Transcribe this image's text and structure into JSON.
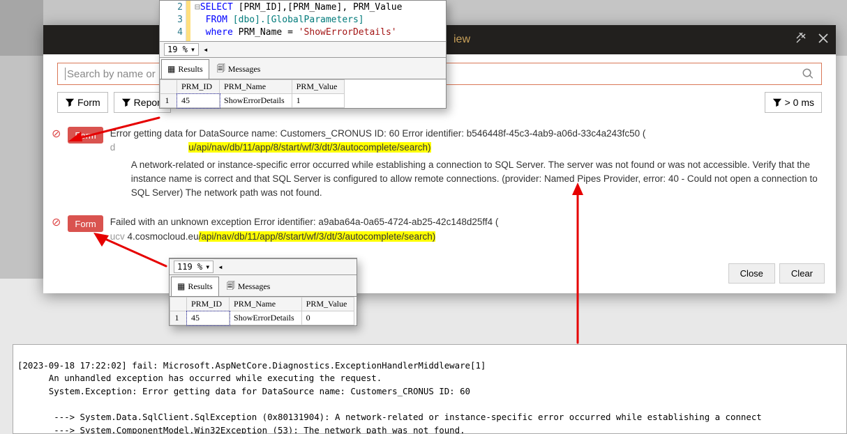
{
  "dialog": {
    "title_fragment": "iew",
    "search_placeholder": "Search by name or",
    "filters": {
      "form": "Form",
      "report": "Report",
      "ms": "> 0 ms"
    },
    "entries": [
      {
        "badge": "Form",
        "msg_pre": "Error getting data for DataSource name: Customers_CRONUS ID: 60 Error identifier: b546448f-45c3-4ab9-a06d-33c4a243fc50 (",
        "msg_hl": "u/api/nav/db/11/app/8/start/wf/3/dt/3/autocomplete/search)",
        "detail": "A network-related or instance-specific error occurred while establishing a connection to SQL Server. The server was not found or was not accessible. Verify that the instance name is correct and that SQL Server is configured to allow remote connections. (provider: Named Pipes Provider, error: 40 - Could not open a connection to SQL Server) The network path was not found."
      },
      {
        "badge": "Form",
        "msg_pre": "Failed with an unknown exception Error identifier: a9aba64a-0a65-4724-ab25-42c148d25ff4 (",
        "msg_mid": "4.cosmocloud.eu",
        "msg_hl": "/api/nav/db/11/app/8/start/wf/3/dt/3/autocomplete/search)"
      }
    ],
    "buttons": {
      "close": "Close",
      "clear": "Clear"
    }
  },
  "sql": {
    "lines": [
      "2",
      "3",
      "4"
    ],
    "sel": "SELECT ",
    "cols": "[PRM_ID],[PRM_Name], PRM_Value",
    "from": "FROM ",
    "tbl": "[dbo].[GlobalParameters]",
    "where": "where ",
    "eqcol": "PRM_Name = ",
    "val": "'ShowErrorDetails'",
    "zoom_top": "19 %",
    "zoom_bottom": "119 %",
    "tabs": {
      "results": "Results",
      "messages": "Messages"
    },
    "cols_h": {
      "id": "PRM_ID",
      "name": "PRM_Name",
      "val": "PRM_Value"
    },
    "row_top": {
      "n": "1",
      "id": "45",
      "name": "ShowErrorDetails",
      "val": "1"
    },
    "row_bottom": {
      "n": "1",
      "id": "45",
      "name": "ShowErrorDetails",
      "val": "0"
    }
  },
  "log": {
    "l1": "[2023-09-18 17:22:02] fail: Microsoft.AspNetCore.Diagnostics.ExceptionHandlerMiddleware[1]",
    "l2": "      An unhandled exception has occurred while executing the request.",
    "l3": "      System.Exception: Error getting data for DataSource name: Customers_CRONUS ID: 60",
    "l4": "       ---> System.Data.SqlClient.SqlException (0x80131904): A network-related or instance-specific error occurred while establishing a connect",
    "l5": "       ---> System.ComponentModel.Win32Exception (53): The network path was not found."
  }
}
